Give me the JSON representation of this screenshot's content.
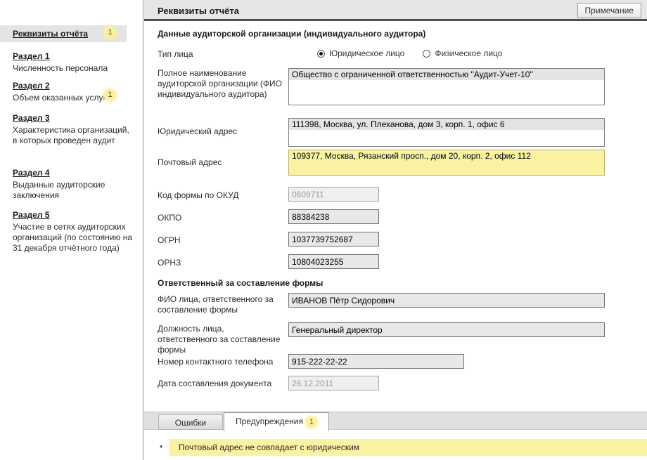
{
  "header": {
    "title": "Реквизиты отчёта",
    "note_button": "Примечание"
  },
  "sidebar": {
    "items": [
      {
        "title": "Реквизиты отчёта",
        "badge": "1"
      },
      {
        "title": "Раздел 1",
        "subtitle": "Численность персонала"
      },
      {
        "title": "Раздел 2",
        "subtitle": "Объем оказанных услуг",
        "badge": "1"
      },
      {
        "title": "Раздел 3",
        "subtitle": "Характеристика организаций, в которых проведен аудит"
      },
      {
        "title": "Раздел 4",
        "subtitle": "Выданные аудиторские заключения"
      },
      {
        "title": "Раздел 5",
        "subtitle": "Участие в сетях аудиторских организаций (по состоянию на 31 декабря отчётного года)"
      }
    ]
  },
  "form": {
    "section_org": "Данные аудиторской организации (индивидуального аудитора)",
    "section_responsible": "Ответственный за составление формы",
    "labels": {
      "type": "Тип лица",
      "full_name": "Полное наименование аудиторской организации (ФИО индивидуального аудитора)",
      "legal_address": "Юридический адрес",
      "postal_address": "Почтовый адрес",
      "okud": "Код формы по ОКУД",
      "okpo": "ОКПО",
      "ogrn": "ОГРН",
      "ornz": "ОРНЗ",
      "fio": "ФИО лица, ответственного за составление формы",
      "position": "Должность лица, ответственного за составление формы",
      "phone": "Номер контактного телефона",
      "date": "Дата составления документа"
    },
    "radios": {
      "legal": "Юридическое лицо",
      "physical": "Физическое лицо",
      "selected": "Юридическое лицо"
    },
    "values": {
      "full_name": "Общество с ограниченной ответственностью \"Аудит-Учет-10\"",
      "legal_address": "111398, Москва, ул. Плеханова, дом 3, корп. 1, офис 6",
      "postal_address": "109377, Москва, Рязанский просп., дом 20, корп. 2, офис 112",
      "okud": "0609711",
      "okpo": "88384238",
      "ogrn": "1037739752687",
      "ornz": "10804023255",
      "fio": "ИВАНОВ Пётр Сидорович",
      "position": "Генеральный директор",
      "phone": "915-222-22-22",
      "date": "26.12.2011"
    }
  },
  "tabs": {
    "errors": "Ошибки",
    "warnings": "Предупреждения",
    "warnings_badge": "1"
  },
  "warning_message": "Почтовый адрес не совпадает с юридическим",
  "colors": {
    "highlight_yellow": "#f8f2a2",
    "badge_yellow": "#f8f2a0",
    "header_gray": "#e6e6e6"
  }
}
